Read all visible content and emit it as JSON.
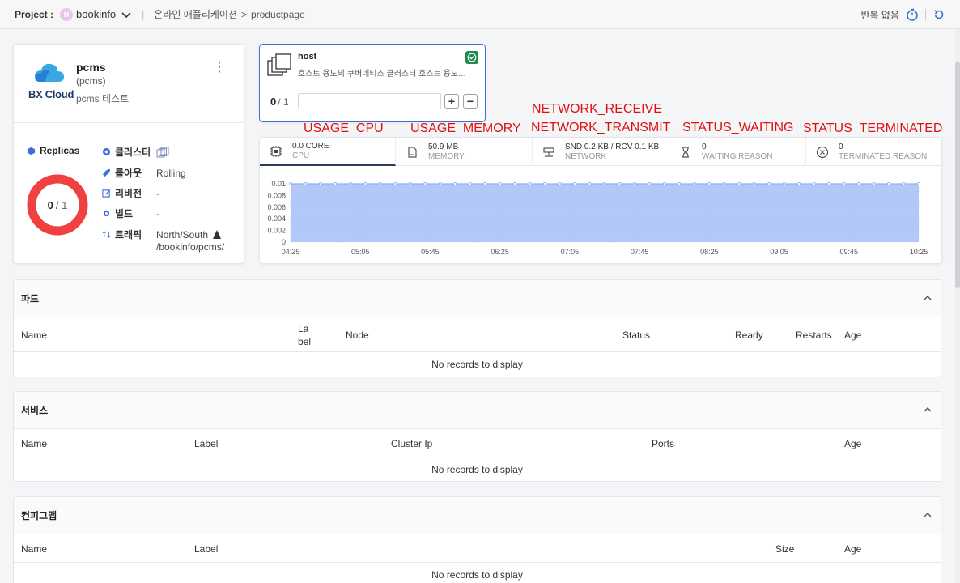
{
  "topbar": {
    "project_label": "Project :",
    "project_badge": "H",
    "project_name": "bookinfo",
    "breadcrumb_app": "온라인 애플리케이션",
    "breadcrumb_sep": ">",
    "breadcrumb_page": "productpage",
    "repeat_label": "반복 없음"
  },
  "app": {
    "logo_text": "BX Cloud",
    "name": "pcms",
    "sub": "(pcms)",
    "desc": "pcms 테스트",
    "replicas_label": "Replicas",
    "replicas_current": "0",
    "replicas_total": "/ 1",
    "info": [
      {
        "key": "클러스터",
        "value": "",
        "icon": "cluster-icon"
      },
      {
        "key": "롤아웃",
        "value": "Rolling",
        "icon": "rocket-icon"
      },
      {
        "key": "리비전",
        "value": "-",
        "icon": "edit-icon"
      },
      {
        "key": "빌드",
        "value": "-",
        "icon": "gear-icon"
      },
      {
        "key": "트래픽",
        "value": "North/South",
        "icon": "traffic-icon"
      }
    ],
    "traffic_path": "/bookinfo/pcms/"
  },
  "host": {
    "name": "host",
    "desc": "호스트 용도의 쿠버네티스 클러스터 호스트 용도…",
    "count": "0",
    "total": "/ 1",
    "plus": "+",
    "minus": "−"
  },
  "annotations": {
    "cpu": "USAGE_CPU",
    "memory": "USAGE_MEMORY",
    "net_receive": "NETWORK_RECEIVE",
    "net_transmit": "NETWORK_TRANSMIT",
    "waiting": "STATUS_WAITING",
    "terminated": "STATUS_TERMINATED"
  },
  "metric_tabs": [
    {
      "value": "0.0 CORE",
      "label": "CPU",
      "icon": "cpu-icon"
    },
    {
      "value": "50.9 MB",
      "label": "MEMORY",
      "icon": "memory-icon"
    },
    {
      "value": "SND 0.2 KB / RCV 0.1 KB",
      "label": "NETWORK",
      "icon": "network-icon"
    },
    {
      "value": "0",
      "label": "WAITING REASON",
      "icon": "hourglass-icon"
    },
    {
      "value": "0",
      "label": "TERMINATED REASON",
      "icon": "close-circle-icon"
    }
  ],
  "chart_data": {
    "type": "area",
    "x": [
      "04:25",
      "05:05",
      "05:45",
      "06:25",
      "07:05",
      "07:45",
      "08:25",
      "09:05",
      "09:45",
      "10:25"
    ],
    "y_ticks": [
      "0.01",
      "0.008",
      "0.006",
      "0.004",
      "0.002",
      "0"
    ],
    "ylim": [
      0,
      0.01
    ],
    "series": [
      {
        "values": [
          0.01,
          0.01,
          0.01,
          0.01,
          0.01,
          0.01,
          0.01,
          0.01,
          0.01,
          0.01
        ]
      }
    ],
    "point_count": 43,
    "color": "#a8c2f7",
    "line_color": "#8fb0f0"
  },
  "sections": {
    "pods": {
      "title": "파드",
      "columns": [
        "Name",
        "La\nbel",
        "Node",
        "Status",
        "Ready",
        "Restarts",
        "Age"
      ],
      "empty": "No records to display"
    },
    "services": {
      "title": "서비스",
      "columns": [
        "Name",
        "Label",
        "Cluster Ip",
        "Ports",
        "Age"
      ],
      "empty": "No records to display"
    },
    "configmaps": {
      "title": "컨피그맵",
      "columns": [
        "Name",
        "Label",
        "Size",
        "Age"
      ],
      "empty": "No records to display"
    }
  }
}
